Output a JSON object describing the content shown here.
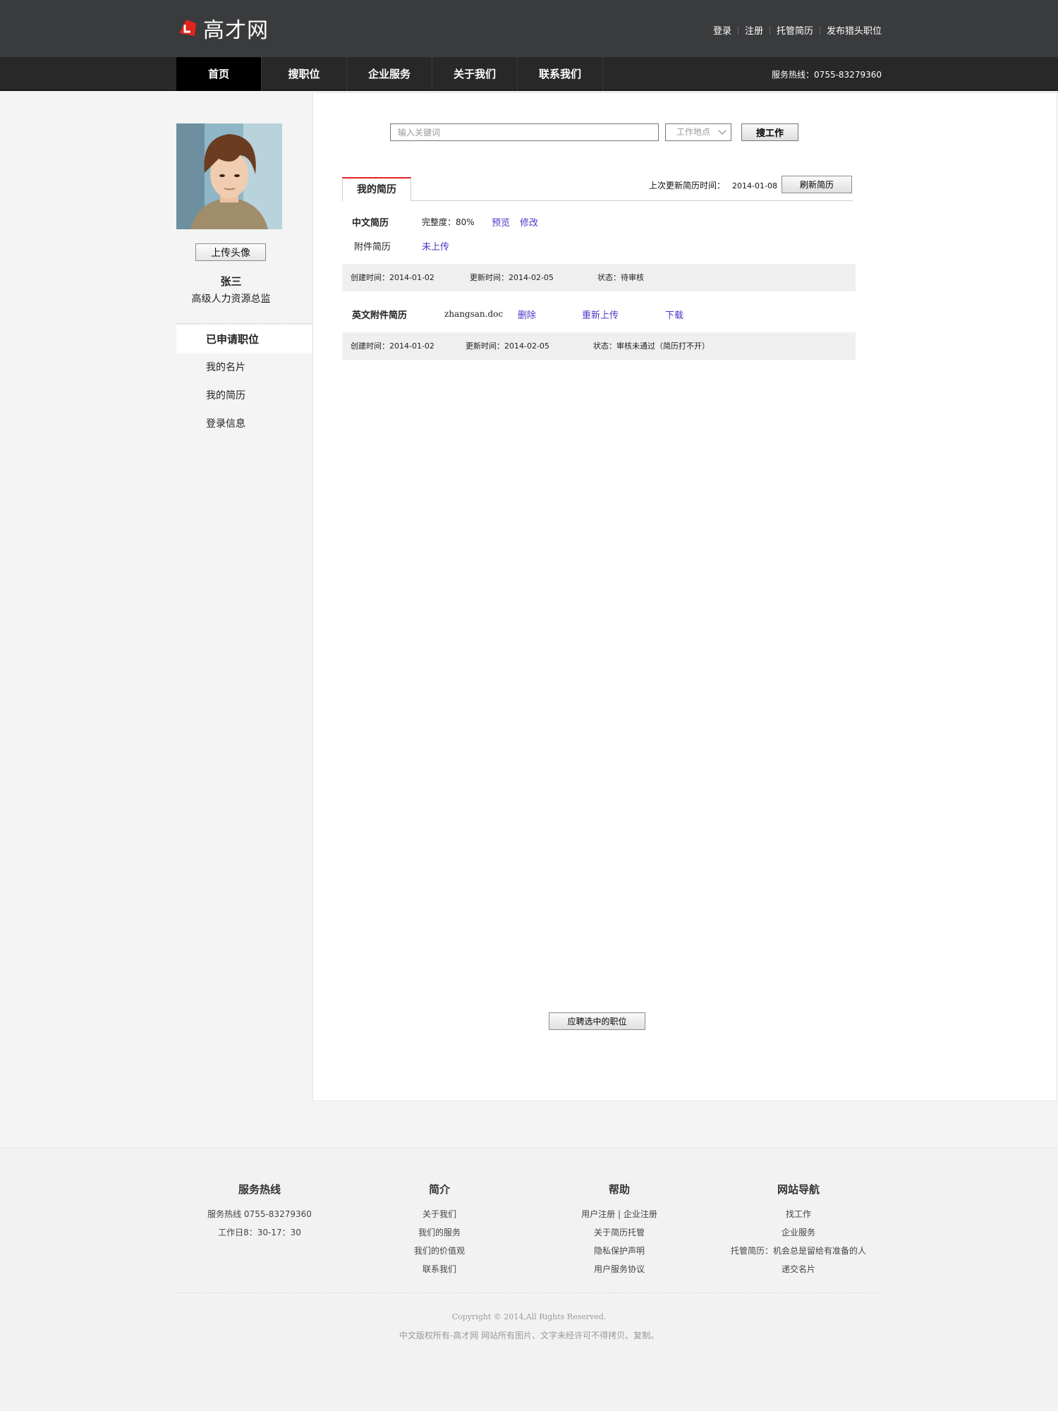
{
  "brand": {
    "name": "高才网"
  },
  "top_links": [
    "登录",
    "注册",
    "托管简历",
    "发布猎头职位"
  ],
  "nav": {
    "items": [
      "首页",
      "搜职位",
      "企业服务",
      "关于我们",
      "联系我们"
    ],
    "hotline": "服务热线：0755-83279360"
  },
  "profile": {
    "upload_label": "上传头像",
    "name": "张三",
    "title": "高级人力资源总监"
  },
  "side_menu": [
    "已申请职位",
    "我的名片",
    "我的简历",
    "登录信息"
  ],
  "search": {
    "placeholder": "输入关键词",
    "location": "工作地点",
    "button": "搜工作"
  },
  "resume": {
    "tab": "我的简历",
    "last_update_label": "上次更新简历时间：",
    "last_update_date": "2014-01-08",
    "refresh_label": "刷新简历",
    "chinese": {
      "label": "中文简历",
      "completeness": "完整度：80%",
      "preview": "预览",
      "edit": "修改",
      "attachment_label": "附件简历",
      "attachment_status": "未上传",
      "created": "创建时间：2014-01-02",
      "updated": "更新时间：2014-02-05",
      "status": "状态：待审核"
    },
    "english": {
      "label": "英文附件简历",
      "file": "zhangsan.doc",
      "delete": "删除",
      "reupload": "重新上传",
      "download": "下载",
      "created": "创建时间：2014-01-02",
      "updated": "更新时间：2014-02-05",
      "status": "状态：审核未通过（简历打不开）"
    },
    "apply_label": "应聘选中的职位"
  },
  "footer": {
    "columns": [
      {
        "title": "服务热线",
        "items": [
          "服务热线 0755-83279360",
          "工作日8：30-17：30"
        ]
      },
      {
        "title": "简介",
        "items": [
          "关于我们",
          "我们的服务",
          "我们的价值观",
          "联系我们"
        ]
      },
      {
        "title": "帮助",
        "items": [
          "用户注册 | 企业注册",
          "关于简历托管",
          "隐私保护声明",
          "用户服务协议"
        ]
      },
      {
        "title": "网站导航",
        "items": [
          "找工作",
          "企业服务",
          "托管简历：机会总是留给有准备的人",
          "递交名片"
        ]
      }
    ],
    "copyright": "Copyright © 2014,All Rights Reserved.",
    "rights": "中文版权所有-高才网 网站所有图片、文字未经许可不得拷贝、复制。"
  },
  "colors": {
    "accent": "#e0241b",
    "link": "#4a38c9",
    "topbar": "#3a3b3d",
    "navbar": "#282828"
  }
}
